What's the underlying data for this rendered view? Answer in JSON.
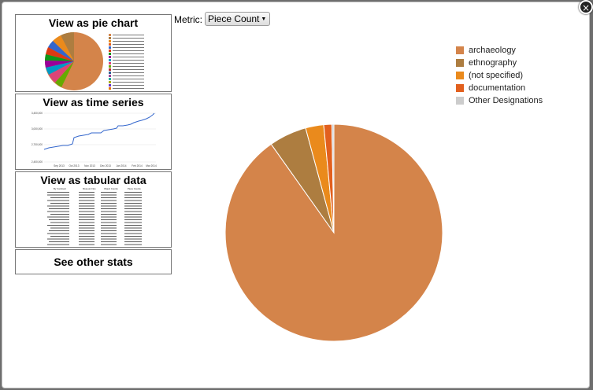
{
  "controls": {
    "metric_label": "Metric:",
    "metric_value": "Piece Count",
    "close_glyph": "×"
  },
  "cards": {
    "pie_title": "View as pie chart",
    "time_title": "View as time series",
    "table_title": "View as tabular data",
    "other_title": "See other stats"
  },
  "thumbnail_time": {
    "y_ticks": [
      "3,400,000",
      "3,000,000",
      "2,700,000",
      "2,400,000"
    ],
    "x_ticks": [
      "Sep 2013",
      "Oct 2013",
      "Nov 2013",
      "Dec 2013",
      "Jan 2014",
      "Feb 2014",
      "Mar 2014"
    ]
  },
  "thumbnail_table": {
    "headers": [
      "By Continent",
      "Museum Nos",
      "Object Counts",
      "Piece Counts"
    ]
  },
  "chart_data": {
    "type": "pie",
    "legend_position": "top-right",
    "slices": [
      {
        "name": "archaeology",
        "value": 90.2,
        "color": "#d4844a"
      },
      {
        "name": "ethnography",
        "value": 5.6,
        "color": "#ad7d40"
      },
      {
        "name": "(not specified)",
        "value": 2.7,
        "color": "#ea8a1c"
      },
      {
        "name": "documentation",
        "value": 1.2,
        "color": "#e2601e"
      },
      {
        "name": "Other Designations",
        "value": 0.3,
        "color": "#cccccc"
      }
    ]
  }
}
